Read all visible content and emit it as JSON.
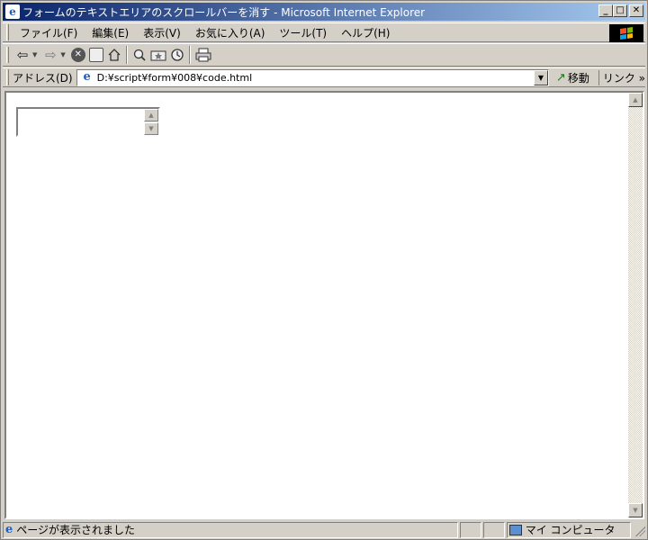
{
  "window": {
    "title": "フォームのテキストエリアのスクロールバーを消す - Microsoft Internet Explorer",
    "minimize": "_",
    "maximize": "□",
    "close": "✕"
  },
  "menu": {
    "items": [
      "ファイル(F)",
      "編集(E)",
      "表示(V)",
      "お気に入り(A)",
      "ツール(T)",
      "ヘルプ(H)"
    ]
  },
  "toolbar": {
    "back_icon": "back-arrow-icon",
    "forward_icon": "forward-arrow-icon",
    "stop_icon": "stop-icon",
    "refresh_icon": "refresh-icon",
    "home_icon": "home-icon",
    "search_icon": "search-icon",
    "favorites_icon": "favorites-icon",
    "history_icon": "history-icon",
    "print_icon": "print-icon"
  },
  "address": {
    "label": "アドレス(D)",
    "value": "D:¥script¥form¥008¥code.html",
    "go_label": "移動",
    "links_label": "リンク »"
  },
  "status": {
    "message": "ページが表示されました",
    "zone": "マイ コンピュータ"
  },
  "colors": {
    "titlebar_start": "#0a246a",
    "titlebar_end": "#a6caf0",
    "chrome": "#d4d0c8"
  }
}
